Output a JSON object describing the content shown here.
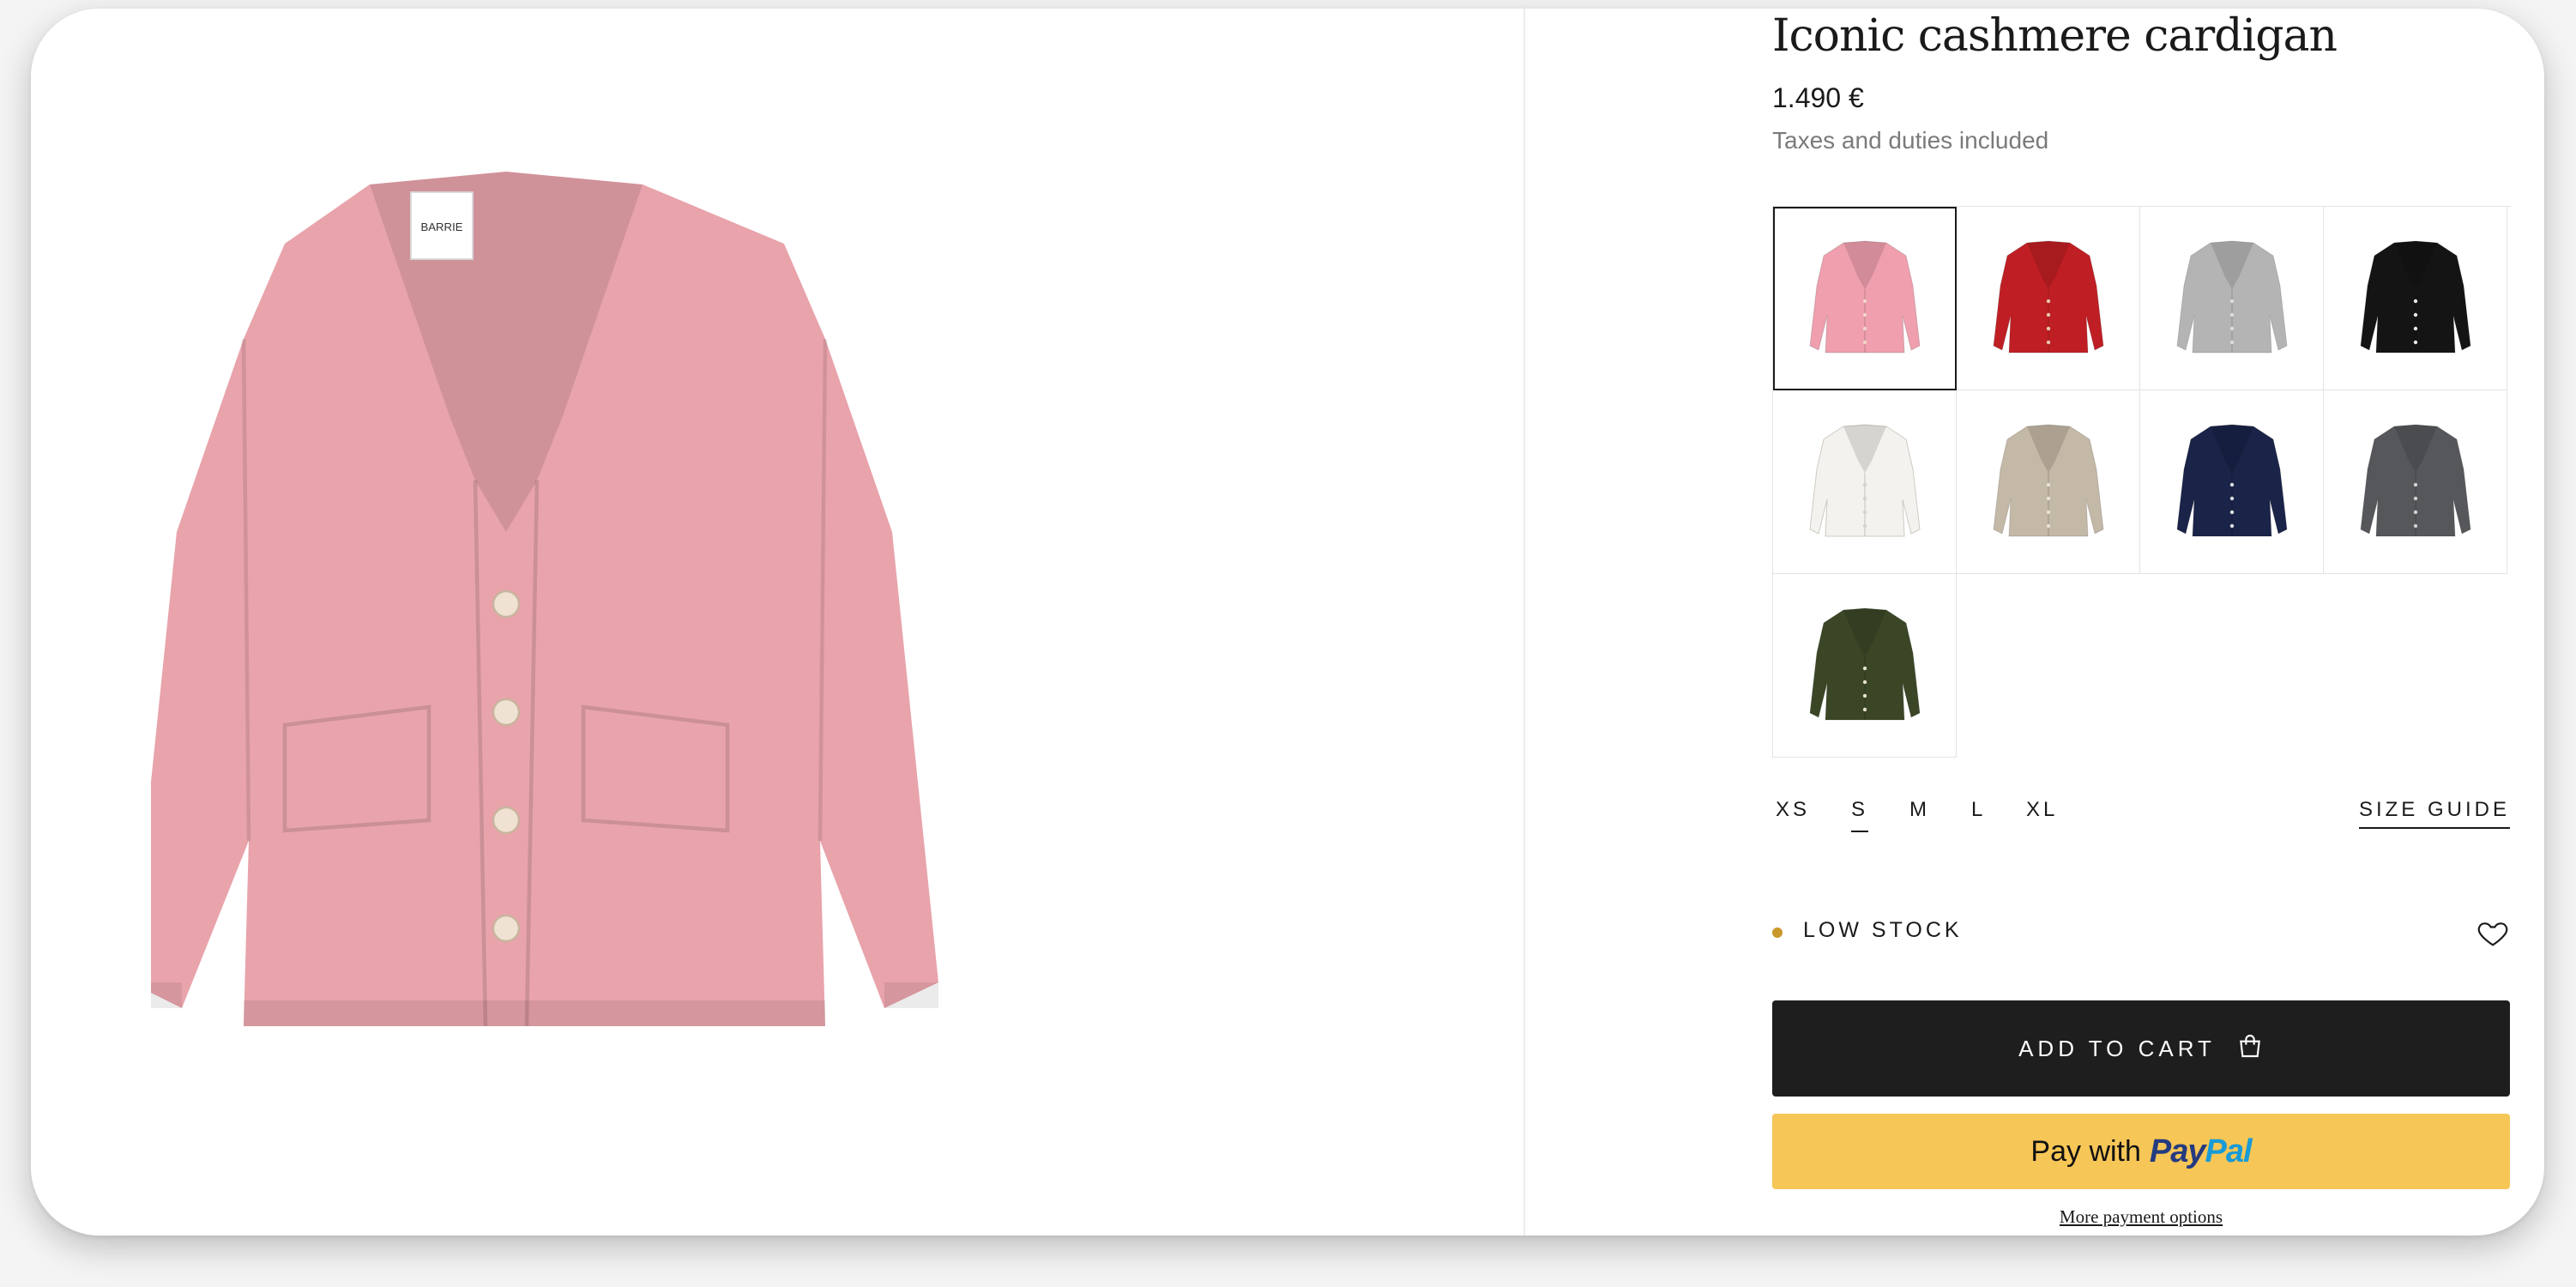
{
  "product": {
    "title": "Iconic cashmere cardigan",
    "price": "1.490 €",
    "tax_note": "Taxes and duties included",
    "label_text": "BARRIE",
    "main_color": "#e8a3ab"
  },
  "swatches": [
    {
      "color": "#ef9fae",
      "selected": true,
      "buttons": "#f1d5c8"
    },
    {
      "color": "#bf1f24",
      "selected": false,
      "buttons": "#e6c7b3"
    },
    {
      "color": "#b4b4b4",
      "selected": false,
      "buttons": "#dcdcdc"
    },
    {
      "color": "#141414",
      "selected": false,
      "buttons": "#e8e8e8"
    },
    {
      "color": "#f4f2ee",
      "selected": false,
      "buttons": "#d6d2cc"
    },
    {
      "color": "#c4b8a6",
      "selected": false,
      "buttons": "#e8e2d6"
    },
    {
      "color": "#1a2348",
      "selected": false,
      "buttons": "#e0e0e0"
    },
    {
      "color": "#55575a",
      "selected": false,
      "buttons": "#d0d0d0"
    },
    {
      "color": "#3a4626",
      "selected": false,
      "buttons": "#e4e1cf"
    }
  ],
  "sizes": [
    "XS",
    "S",
    "M",
    "L",
    "XL"
  ],
  "selected_size": "S",
  "size_guide_label": "SIZE GUIDE",
  "stock": {
    "label": "LOW STOCK",
    "dot_color": "#c9982c"
  },
  "add_to_cart_label": "ADD TO CART",
  "paypal": {
    "pay_with": "Pay with",
    "pay": "Pay",
    "pal": "Pal"
  },
  "more_payment_label": "More payment options"
}
